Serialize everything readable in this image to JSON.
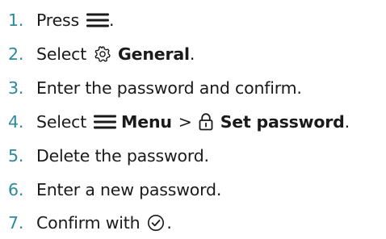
{
  "steps": [
    {
      "number": "1.",
      "before": "Press",
      "icon": "menu-icon",
      "after": "."
    },
    {
      "number": "2.",
      "before": "Select",
      "icon": "gear-icon",
      "bold": "General",
      "after": "."
    },
    {
      "number": "3.",
      "text": "Enter the password and confirm."
    },
    {
      "number": "4.",
      "before": "Select",
      "icon": "menu-icon",
      "bold": "Menu",
      "separator": ">",
      "icon2": "lock-icon",
      "bold2": "Set password",
      "after": "."
    },
    {
      "number": "5.",
      "text": "Delete the password."
    },
    {
      "number": "6.",
      "text": "Enter a new password."
    },
    {
      "number": "7.",
      "before": "Confirm with",
      "icon": "check-circle-icon",
      "after": "."
    }
  ],
  "colors": {
    "number": "#2c8a9a",
    "text": "#1a1a1a"
  }
}
